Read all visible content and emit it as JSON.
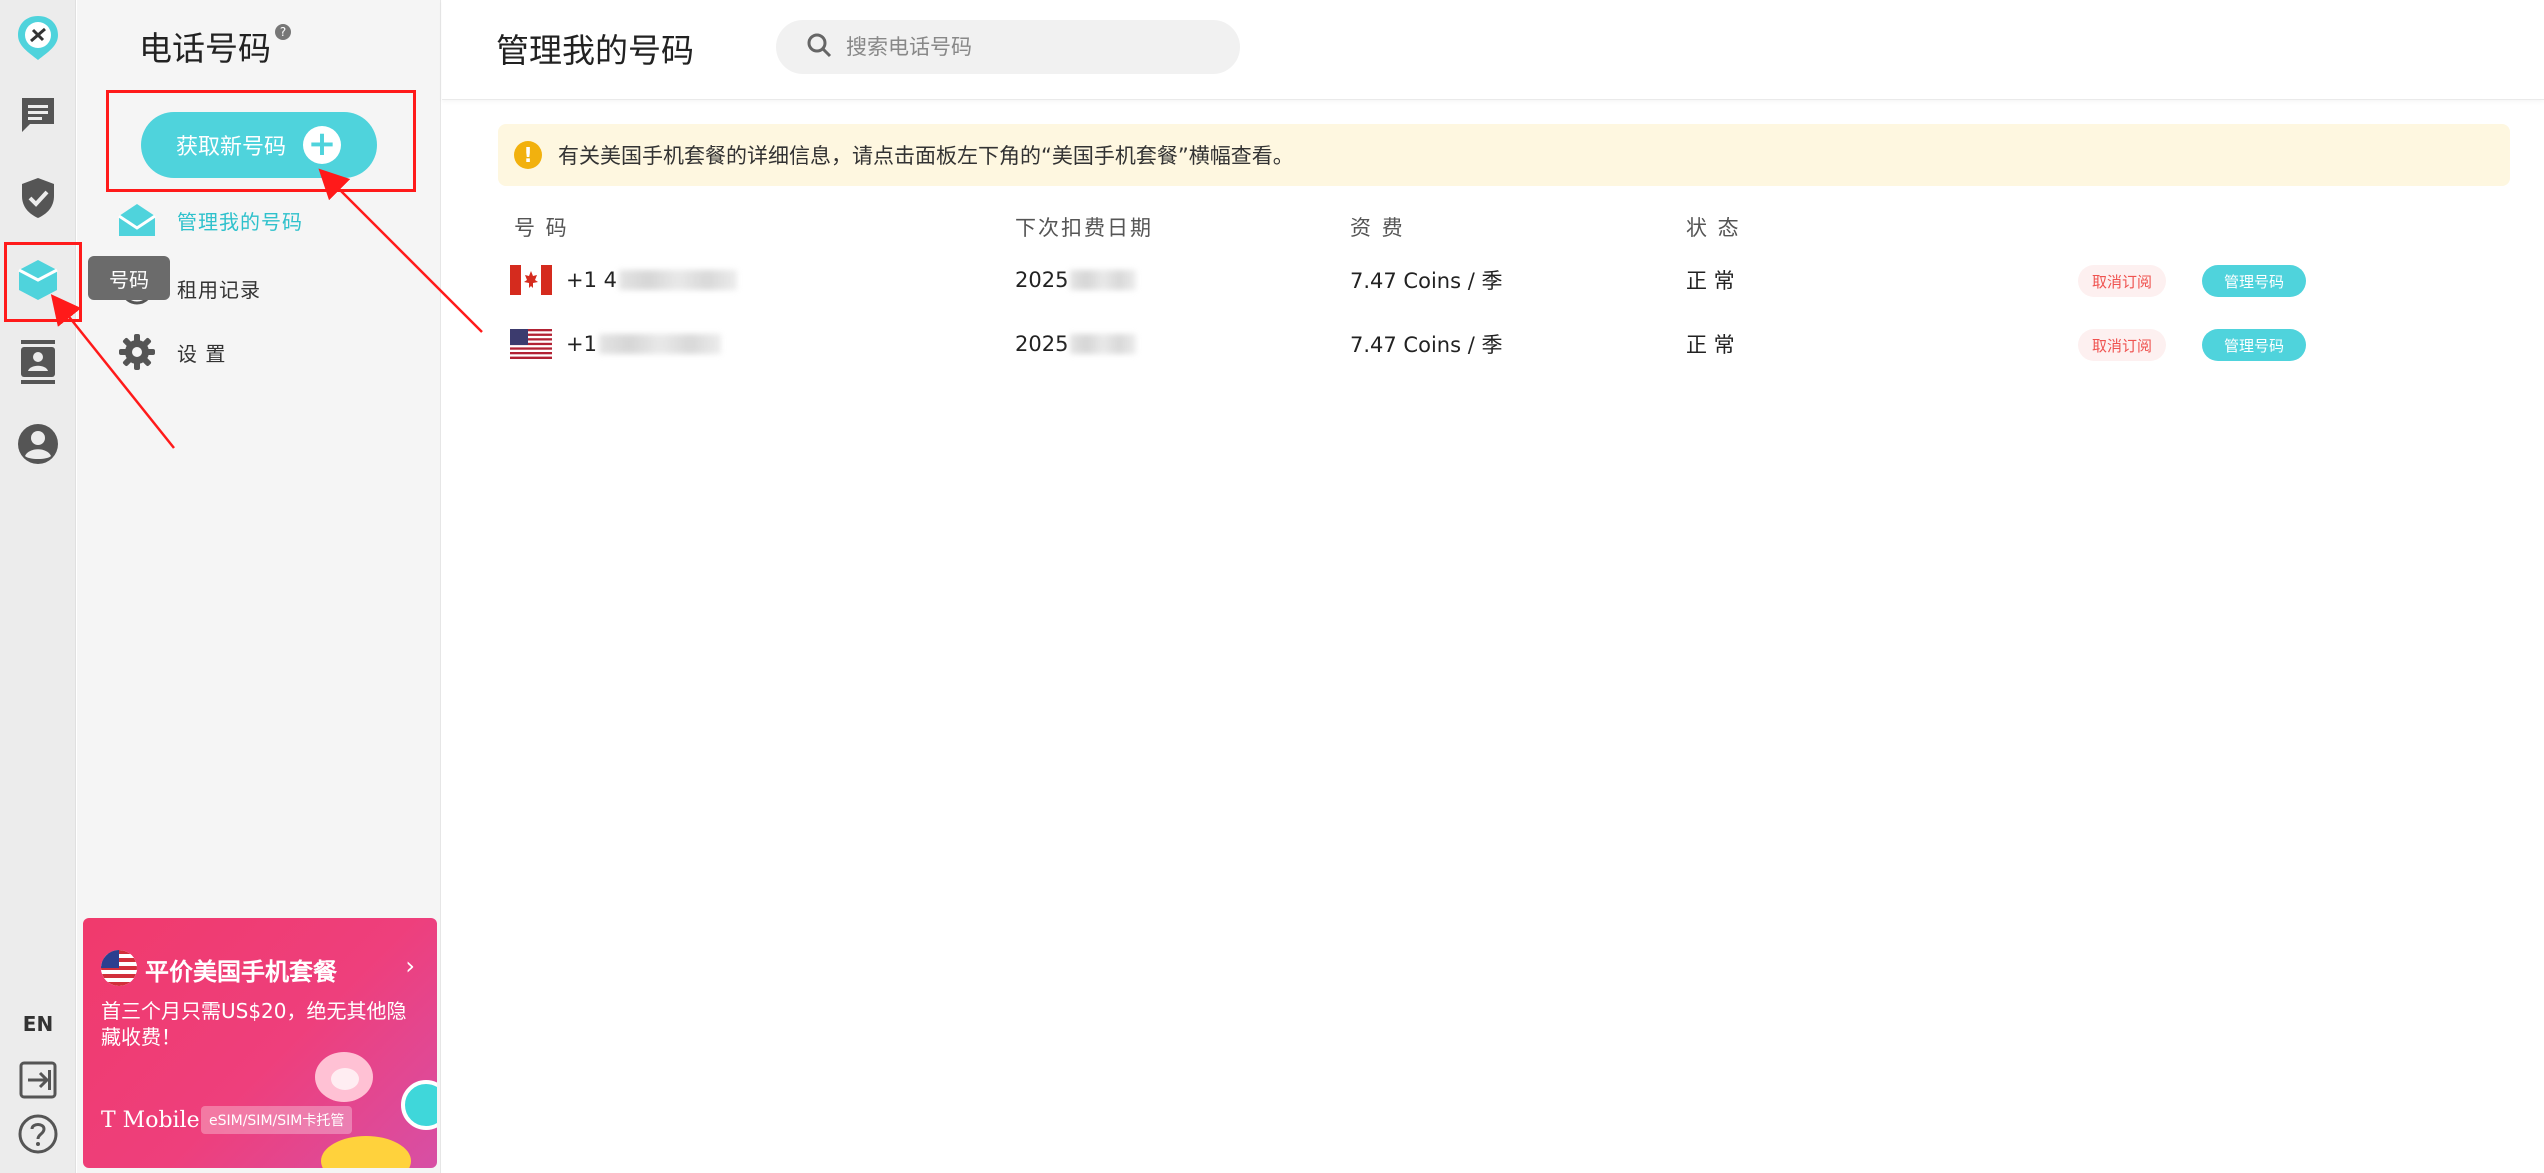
{
  "rail": {
    "lang_label": "EN",
    "tooltip": "号码",
    "accent": "#4fd3dc"
  },
  "sidebar": {
    "title": "电话号码",
    "help_mark": "?",
    "get_button_label": "获取新号码",
    "items": [
      {
        "label": "管理我的号码",
        "icon": "envelope-icon",
        "active": true
      },
      {
        "label": "租用记录",
        "icon": "history-icon",
        "active": false
      },
      {
        "label": "设 置",
        "icon": "gear-icon",
        "active": false
      }
    ],
    "promo": {
      "title": "平价美国手机套餐",
      "arrow": "›",
      "desc": "首三个月只需US$20，绝无其他隐藏收费！",
      "brand": "T Mobile",
      "tag": "eSIM/SIM/SIM卡托管"
    }
  },
  "header": {
    "title": "管理我的号码",
    "search_placeholder": "搜索电话号码"
  },
  "notice": {
    "icon_text": "!",
    "text": "有关美国手机套餐的详细信息，请点击面板左下角的“美国手机套餐”横幅查看。"
  },
  "table": {
    "headers": {
      "number": "号 码",
      "next_charge": "下次扣费日期",
      "fee": "资 费",
      "status": "状 态"
    },
    "rows": [
      {
        "flag": "canada-flag-icon",
        "number_prefix": "+1 4",
        "date_prefix": "2025",
        "fee": "7.47 Coins / 季",
        "status": "正 常",
        "cancel": "取消订阅",
        "manage": "管理号码"
      },
      {
        "flag": "usa-flag-icon",
        "number_prefix": "+1",
        "date_prefix": "2025",
        "fee": "7.47 Coins / 季",
        "status": "正 常",
        "cancel": "取消订阅",
        "manage": "管理号码"
      }
    ]
  }
}
